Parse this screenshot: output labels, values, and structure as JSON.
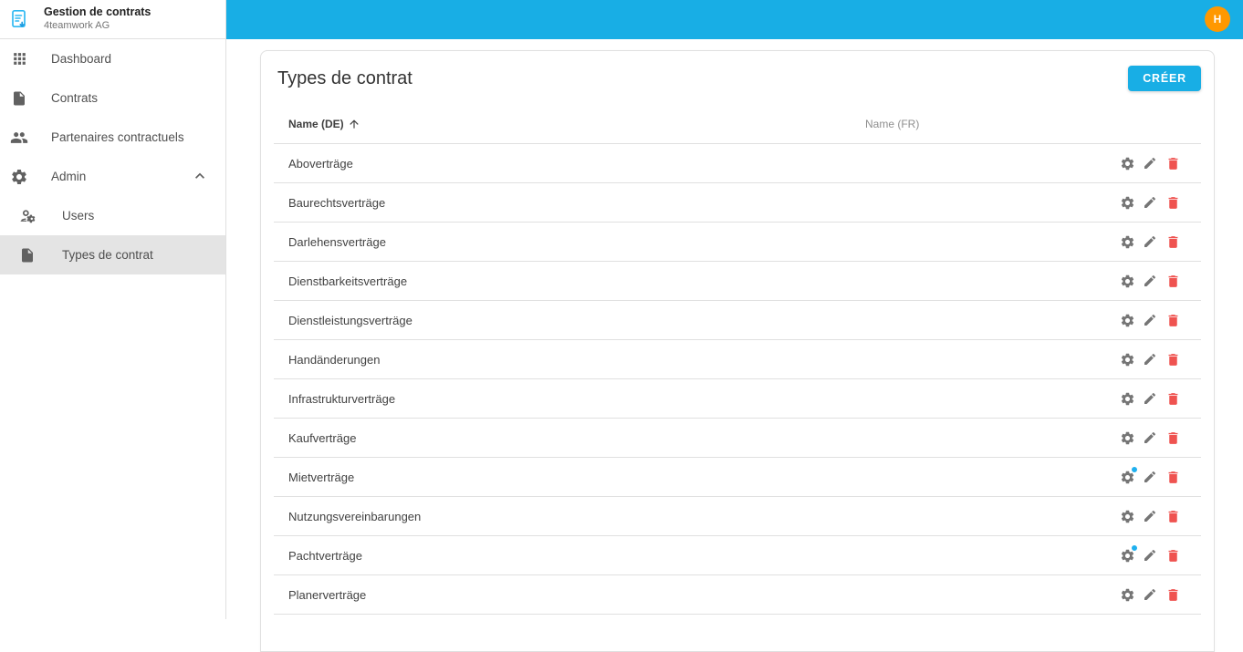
{
  "app": {
    "title": "Gestion de contrats",
    "subtitle": "4teamwork AG"
  },
  "colors": {
    "accent": "#18aee5",
    "avatar_bg": "#ff9800",
    "delete": "#ef5350"
  },
  "topbar": {
    "avatar_initial": "H"
  },
  "sidebar": {
    "items": [
      {
        "label": "Dashboard",
        "icon": "apps-icon"
      },
      {
        "label": "Contrats",
        "icon": "file-icon"
      },
      {
        "label": "Partenaires contractuels",
        "icon": "people-icon"
      },
      {
        "label": "Admin",
        "icon": "gear-icon",
        "expanded": true
      },
      {
        "label": "Users",
        "icon": "user-gear-icon",
        "child": true
      },
      {
        "label": "Types de contrat",
        "icon": "file-icon",
        "child": true,
        "selected": true
      }
    ]
  },
  "main": {
    "title": "Types de contrat",
    "create_button_label": "CRÉER",
    "table": {
      "columns": {
        "de": "Name (DE)",
        "fr": "Name (FR)"
      },
      "sort": {
        "column": "Name (DE)",
        "direction": "ascending"
      },
      "rows": [
        {
          "name_de": "Aboverträge",
          "name_fr": "",
          "badge": false
        },
        {
          "name_de": "Baurechtsverträge",
          "name_fr": "",
          "badge": false
        },
        {
          "name_de": "Darlehensverträge",
          "name_fr": "",
          "badge": false
        },
        {
          "name_de": "Dienstbarkeitsverträge",
          "name_fr": "",
          "badge": false
        },
        {
          "name_de": "Dienstleistungsverträge",
          "name_fr": "",
          "badge": false
        },
        {
          "name_de": "Handänderungen",
          "name_fr": "",
          "badge": false
        },
        {
          "name_de": "Infrastrukturverträge",
          "name_fr": "",
          "badge": false
        },
        {
          "name_de": "Kaufverträge",
          "name_fr": "",
          "badge": false
        },
        {
          "name_de": "Mietverträge",
          "name_fr": "",
          "badge": true
        },
        {
          "name_de": "Nutzungsvereinbarungen",
          "name_fr": "",
          "badge": false
        },
        {
          "name_de": "Pachtverträge",
          "name_fr": "",
          "badge": true
        },
        {
          "name_de": "Planerverträge",
          "name_fr": "",
          "badge": false
        }
      ]
    }
  }
}
